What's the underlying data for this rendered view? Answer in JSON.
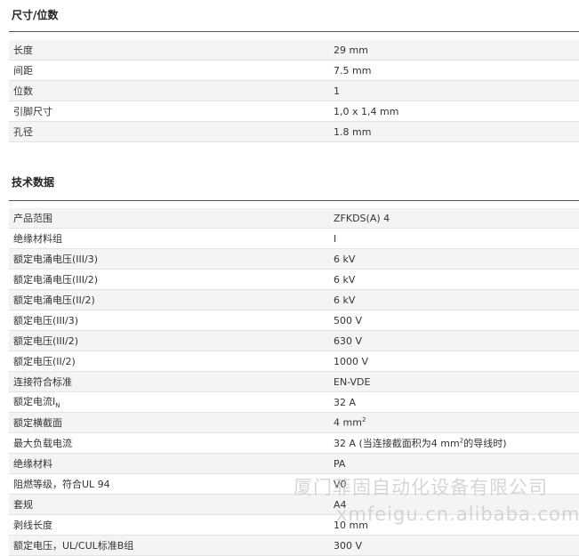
{
  "dimensions": {
    "title": "尺寸/位数",
    "rows": [
      {
        "label": "长度",
        "value": "29 mm"
      },
      {
        "label": "间距",
        "value": "7.5 mm"
      },
      {
        "label": "位数",
        "value": "1"
      },
      {
        "label": "引脚尺寸",
        "value": "1,0 x 1,4 mm"
      },
      {
        "label": "孔径",
        "value": "1.8 mm"
      }
    ]
  },
  "tech": {
    "title": "技术数据",
    "rows": [
      {
        "label": "产品范围",
        "value": "ZFKDS(A) 4"
      },
      {
        "label": "绝缘材料组",
        "value": "I"
      },
      {
        "label": "额定电涌电压(III/3)",
        "value": "6 kV"
      },
      {
        "label": "额定电涌电压(III/2)",
        "value": "6 kV"
      },
      {
        "label": "额定电涌电压(II/2)",
        "value": "6 kV"
      },
      {
        "label": "额定电压(III/3)",
        "value": "500 V"
      },
      {
        "label": "额定电压(III/2)",
        "value": "630 V"
      },
      {
        "label": "额定电压(II/2)",
        "value": "1000 V"
      },
      {
        "label": "连接符合标准",
        "value": "EN-VDE"
      },
      {
        "label": "额定电流I",
        "label_sub": "N",
        "value": "32 A"
      },
      {
        "label": "额定横截面",
        "value": "4 mm",
        "value_sup": "2"
      },
      {
        "label": "最大负载电流",
        "value": "32 A (当连接截面积为4 mm",
        "value_sup": "2",
        "value_tail": "的导线时)"
      },
      {
        "label": "绝缘材料",
        "value": "PA"
      },
      {
        "label": "阻燃等级，符合UL 94",
        "value": "V0"
      },
      {
        "label": "套规",
        "value": "A4"
      },
      {
        "label": "剥线长度",
        "value": "10 mm"
      },
      {
        "label": "额定电压，UL/CUL标准B组",
        "value": "300 V"
      }
    ]
  },
  "watermark": {
    "line1": "厦门菲固自动化设备有限公司",
    "line2": "xmfeigu.cn.alibaba.com"
  }
}
